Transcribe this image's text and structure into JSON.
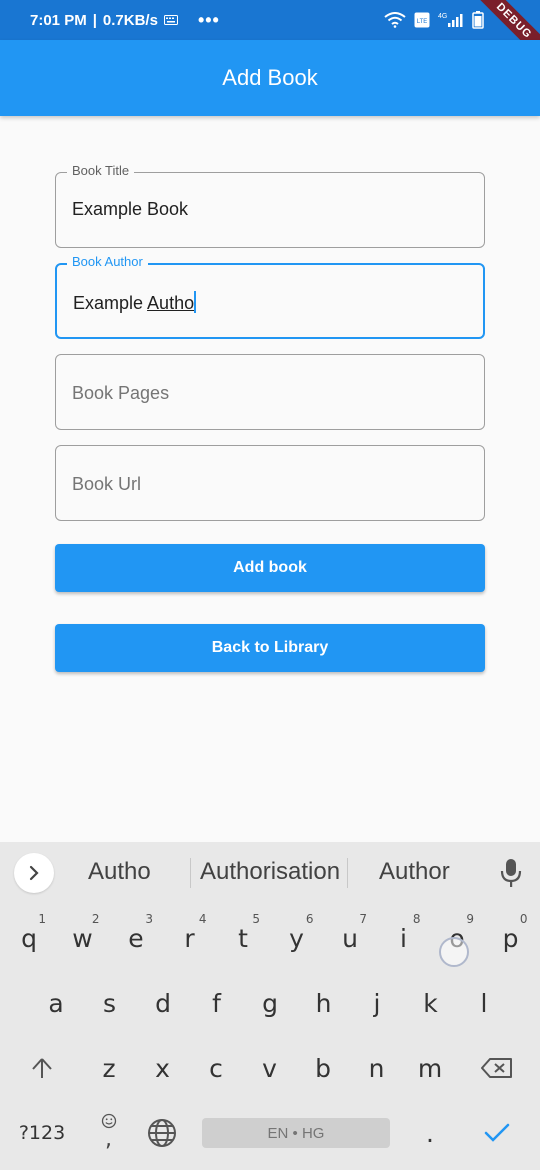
{
  "status_bar": {
    "time": "7:01 PM",
    "speed": "0.7KB/s",
    "more": "•••",
    "network": "4G",
    "debug_label": "DEBUG"
  },
  "app_bar": {
    "title": "Add Book"
  },
  "form": {
    "title_field": {
      "label": "Book Title",
      "value": "Example Book"
    },
    "author_field": {
      "label": "Book Author",
      "value_prefix": "Example ",
      "value_composing": "Autho"
    },
    "pages_field": {
      "placeholder": "Book Pages"
    },
    "url_field": {
      "placeholder": "Book Url"
    }
  },
  "buttons": {
    "add_book": "Add book",
    "back_to_library": "Back to Library"
  },
  "keyboard": {
    "suggestions": [
      "Autho",
      "Authorisation",
      "Author"
    ],
    "row1": [
      {
        "k": "q",
        "n": "1"
      },
      {
        "k": "w",
        "n": "2"
      },
      {
        "k": "e",
        "n": "3"
      },
      {
        "k": "r",
        "n": "4"
      },
      {
        "k": "t",
        "n": "5"
      },
      {
        "k": "y",
        "n": "6"
      },
      {
        "k": "u",
        "n": "7"
      },
      {
        "k": "i",
        "n": "8"
      },
      {
        "k": "o",
        "n": "9"
      },
      {
        "k": "p",
        "n": "0"
      }
    ],
    "row2": [
      "a",
      "s",
      "d",
      "f",
      "g",
      "h",
      "j",
      "k",
      "l"
    ],
    "row3": [
      "z",
      "x",
      "c",
      "v",
      "b",
      "n",
      "m"
    ],
    "symbols_key": "?123",
    "space_label": "EN • HG",
    "period_key": ".",
    "comma_key": ","
  },
  "colors": {
    "primary": "#2196F3",
    "status_bar": "#1976D2",
    "debug_ribbon": "#7a1f2b"
  }
}
